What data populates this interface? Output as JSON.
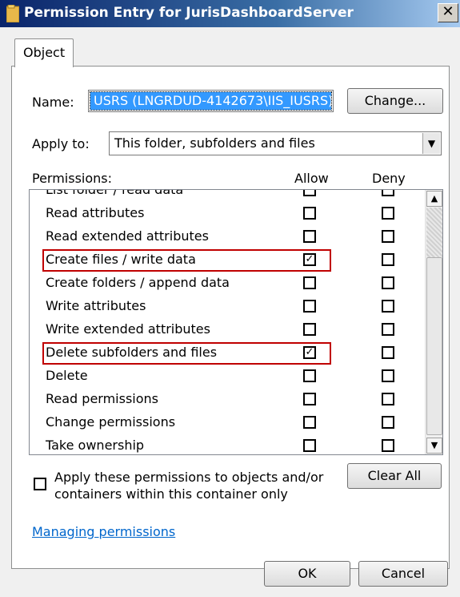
{
  "window": {
    "title": "Permission Entry for JurisDashboardServer",
    "close_label": "✕"
  },
  "tabs": [
    {
      "label": "Object"
    }
  ],
  "name_field": {
    "label": "Name:",
    "value": "USRS (LNGRDUD-4142673\\IIS_IUSRS)"
  },
  "change_button": {
    "label": "Change..."
  },
  "apply_to": {
    "label": "Apply to:",
    "value": "This folder, subfolders and files"
  },
  "permissions": {
    "header": "Permissions:",
    "allow_header": "Allow",
    "deny_header": "Deny",
    "rows": [
      {
        "label": "List folder / read data",
        "allow": false,
        "deny": false
      },
      {
        "label": "Read attributes",
        "allow": false,
        "deny": false
      },
      {
        "label": "Read extended attributes",
        "allow": false,
        "deny": false
      },
      {
        "label": "Create files / write data",
        "allow": true,
        "deny": false
      },
      {
        "label": "Create folders / append data",
        "allow": false,
        "deny": false
      },
      {
        "label": "Write attributes",
        "allow": false,
        "deny": false
      },
      {
        "label": "Write extended attributes",
        "allow": false,
        "deny": false
      },
      {
        "label": "Delete subfolders and files",
        "allow": true,
        "deny": false
      },
      {
        "label": "Delete",
        "allow": false,
        "deny": false
      },
      {
        "label": "Read permissions",
        "allow": false,
        "deny": false
      },
      {
        "label": "Change permissions",
        "allow": false,
        "deny": false
      },
      {
        "label": "Take ownership",
        "allow": false,
        "deny": false
      }
    ],
    "highlighted_rows": [
      "Create files / write data",
      "Delete subfolders and files"
    ],
    "highlight_color": "#c00000"
  },
  "apply_option": {
    "label_line1": "Apply these permissions to objects and/or",
    "label_line2": "containers within this container only",
    "checked": false
  },
  "clear_all_button": {
    "label": "Clear All"
  },
  "help_link": {
    "label": "Managing permissions"
  },
  "footer": {
    "ok_label": "OK",
    "cancel_label": "Cancel"
  },
  "icons": {
    "title": "folder-icon",
    "dropdown": "chevron-down-icon",
    "scroll_up": "arrow-up-icon",
    "scroll_down": "arrow-down-icon"
  }
}
